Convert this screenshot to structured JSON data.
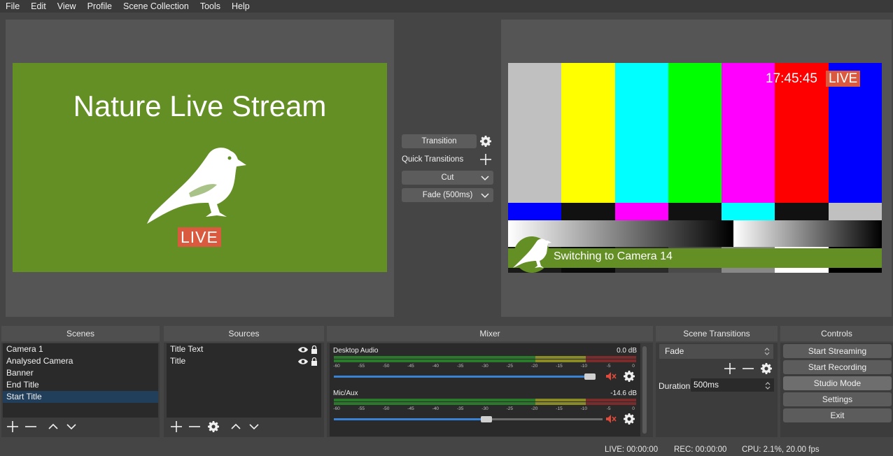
{
  "menu": [
    "File",
    "Edit",
    "View",
    "Profile",
    "Scene Collection",
    "Tools",
    "Help"
  ],
  "preview": {
    "title": "Nature Live Stream",
    "live_badge": "LIVE"
  },
  "program": {
    "clock": "17:45:45",
    "live_badge": "LIVE",
    "lower_third": "Switching to Camera 14",
    "bar_colors_top": [
      "#c0c0c0",
      "#ffff00",
      "#00ffff",
      "#00ff00",
      "#ff00ff",
      "#ff0000",
      "#0000ff"
    ],
    "bar_colors_mid": [
      "#0000ff",
      "#111111",
      "#ff00ff",
      "#111111",
      "#00ffff",
      "#111111",
      "#c0c0c0"
    ]
  },
  "transition": {
    "button_label": "Transition",
    "quick_label": "Quick Transitions",
    "quick_items": [
      "Cut",
      "Fade (500ms)"
    ]
  },
  "docks": {
    "scenes": "Scenes",
    "sources": "Sources",
    "mixer": "Mixer",
    "scene_transitions": "Scene Transitions",
    "controls": "Controls"
  },
  "scenes": [
    "Camera 1",
    "Analysed Camera",
    "Banner",
    "End Title",
    "Start Title"
  ],
  "scenes_selected": 4,
  "sources": [
    "Title Text",
    "Title"
  ],
  "mixer": {
    "ticks": [
      "-60",
      "-55",
      "-50",
      "-45",
      "-40",
      "-35",
      "-30",
      "-25",
      "-20",
      "-15",
      "-10",
      "-5",
      "0"
    ],
    "channels": [
      {
        "name": "Desktop Audio",
        "db": "0.0 dB",
        "volume": 1.0
      },
      {
        "name": "Mic/Aux",
        "db": "-14.6 dB",
        "volume": 0.57
      }
    ]
  },
  "scene_transitions": {
    "selected": "Fade",
    "duration_label": "Duration",
    "duration_value": "500ms"
  },
  "controls": [
    "Start Streaming",
    "Start Recording",
    "Studio Mode",
    "Settings",
    "Exit"
  ],
  "status": {
    "live": "LIVE: 00:00:00",
    "rec": "REC: 00:00:00",
    "cpu": "CPU: 2.1%, 20.00 fps"
  }
}
